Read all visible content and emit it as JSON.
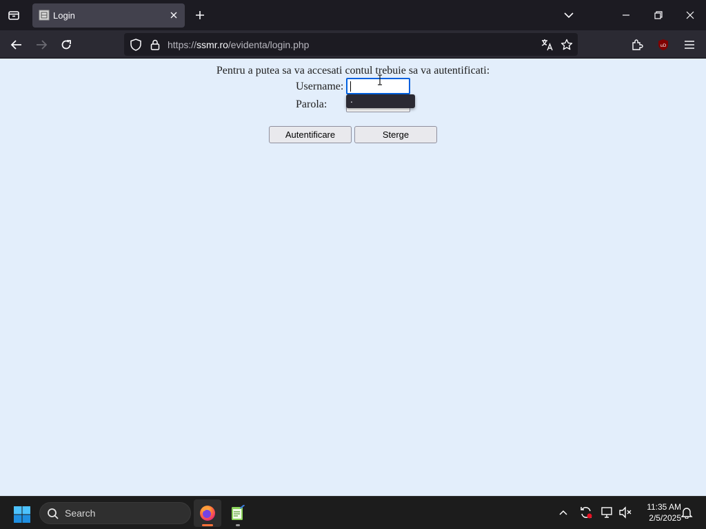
{
  "browser": {
    "tab_title": "Login",
    "url_scheme": "https://",
    "url_host": "ssmr.ro",
    "url_path": "/evidenta/login.php"
  },
  "page": {
    "intro": "Pentru a putea sa va accesati contul trebuie sa va autentificati:",
    "username_label": "Username:",
    "username_value": "",
    "password_label": "Parola:",
    "password_value": "",
    "autofill_item": ".",
    "login_button": "Autentificare",
    "clear_button": "Sterge"
  },
  "taskbar": {
    "search_placeholder": "Search",
    "time": "11:35 AM",
    "date": "2/5/2025"
  },
  "colors": {
    "page_background": "#e3eefb",
    "focus_ring": "#0060df",
    "firefox_indicator": "#ff7139",
    "ublock_red": "#800000"
  }
}
